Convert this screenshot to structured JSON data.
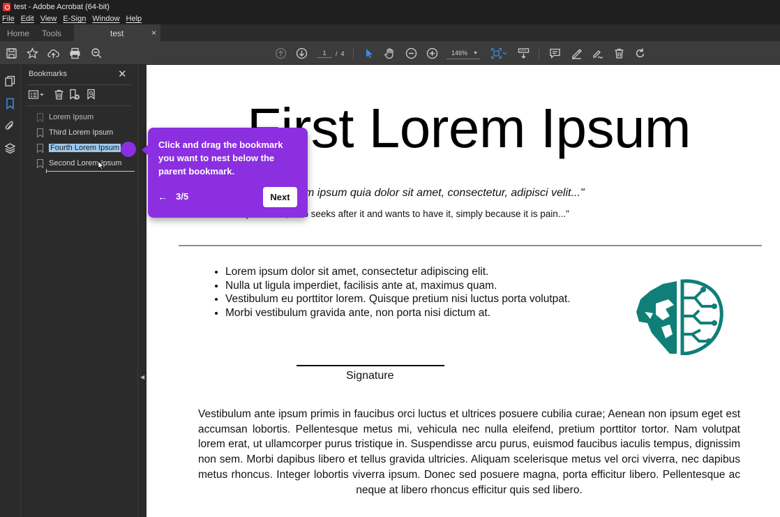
{
  "window": {
    "title": "test - Adobe Acrobat (64-bit)"
  },
  "menu": {
    "items": [
      "File",
      "Edit",
      "View",
      "E-Sign",
      "Window",
      "Help"
    ]
  },
  "tabs": {
    "home": "Home",
    "tools": "Tools",
    "document": "test",
    "close": "×"
  },
  "toolbar": {
    "page_current": "1",
    "page_separator": "/",
    "page_total": "4",
    "zoom": "146%",
    "icons": [
      "save-icon",
      "star-icon",
      "cloud-upload-icon",
      "print-icon",
      "zoom-search-icon",
      "page-up-icon",
      "page-down-icon",
      "select-arrow-icon",
      "hand-icon",
      "zoom-out-icon",
      "zoom-in-icon",
      "fit-page-icon",
      "scroll-mode-icon",
      "comment-icon",
      "highlight-icon",
      "sign-icon",
      "delete-icon",
      "rotate-icon"
    ]
  },
  "bookmarks": {
    "title": "Bookmarks",
    "close": "✕",
    "items": [
      {
        "label": "Lorem Ipsum"
      },
      {
        "label": "Third Lorem Ipsum"
      },
      {
        "label": "Fourth Lorem Ipsum"
      },
      {
        "label": "Second Lorem Ipsum"
      }
    ]
  },
  "coach": {
    "text": "Click and drag the bookmark you want to nest below the parent bookmark.",
    "back": "←",
    "step": "3/5",
    "next": "Next"
  },
  "document": {
    "title": "First Lorem Ipsum",
    "quote": "uisquam est qui dolorem ipsum quia dolor sit amet, consectetur, adipisci velit...\"",
    "subquote": "ne who loves pain itself, who seeks after it and wants to have it, simply because it is pain...\"",
    "bullets": [
      "Lorem ipsum dolor sit amet, consectetur adipiscing elit.",
      "Nulla ut ligula imperdiet, facilisis ante at, maximus quam.",
      "Vestibulum eu porttitor lorem. Quisque pretium nisi luctus porta volutpat.",
      "Morbi vestibulum gravida ante, non porta nisi dictum at."
    ],
    "signature_label": "Signature",
    "paragraph": "Vestibulum ante ipsum primis in faucibus orci luctus et ultrices posuere cubilia curae; Aenean non ipsum eget est accumsan lobortis. Pellentesque metus mi, vehicula nec nulla eleifend, pretium porttitor tortor. Nam volutpat lorem erat, ut ullamcorper purus tristique in. Suspendisse arcu purus, euismod faucibus iaculis tempus, dignissim non sem. Morbi dapibus libero et tellus gravida ultricies. Aliquam scelerisque metus vel orci viverra, nec dapibus metus rhoncus. Integer lobortis viverra ipsum. Donec sed posuere magna, porta efficitur libero. Pellentesque ac neque at libero rhoncus efficitur quis sed libero.",
    "logo_color": "#0f7f78"
  },
  "colors": {
    "accent": "#8b2fe0",
    "selection": "#9ec9ec",
    "active_icon": "#3d8ee6"
  }
}
